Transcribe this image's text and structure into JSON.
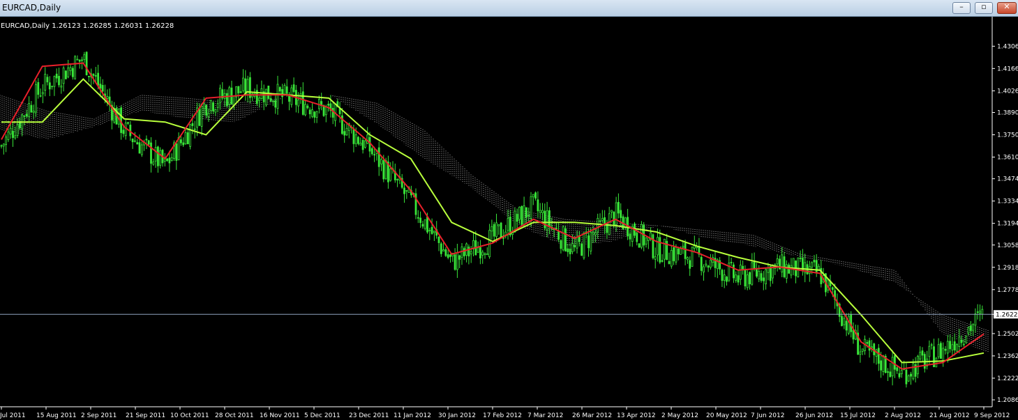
{
  "window": {
    "title": "EURCAD,Daily",
    "minimize_glyph": "–",
    "restore_glyph": "▫",
    "close_glyph": "✕"
  },
  "chart_info": {
    "text": "EURCAD,Daily  1.26123 1.26285 1.26031 1.26228"
  },
  "colors": {
    "background": "#000000",
    "candles": "#39e639",
    "tenkan": "#e8202a",
    "kijun": "#b8ff3c",
    "cloud": "#ffffff",
    "axis": "#ffffff",
    "current_price_line": "#8fa3c0"
  },
  "price_axis": [
    "1.43060",
    "1.41660",
    "1.40260",
    "1.38900",
    "1.37500",
    "1.36100",
    "1.34740",
    "1.33340",
    "1.31940",
    "1.30580",
    "1.29180",
    "1.27780",
    "1.26228",
    "1.25020",
    "1.23620",
    "1.22220",
    "1.20860"
  ],
  "current_price": "1.26228",
  "time_axis": [
    "Jul 2011",
    "15 Aug 2011",
    "2 Sep 2011",
    "21 Sep 2011",
    "10 Oct 2011",
    "28 Oct 2011",
    "16 Nov 2011",
    "5 Dec 2011",
    "23 Dec 2011",
    "11 Jan 2012",
    "30 Jan 2012",
    "17 Feb 2012",
    "7 Mar 2012",
    "26 Mar 2012",
    "13 Apr 2012",
    "2 May 2012",
    "20 May 2012",
    "7 Jun 2012",
    "26 Jun 2012",
    "15 Jul 2012",
    "2 Aug 2012",
    "21 Aug 2012",
    "9 Sep 2012"
  ],
  "chart_data": {
    "type": "candlestick",
    "symbol": "EURCAD",
    "timeframe": "Daily",
    "last_bar": {
      "open": 1.26123,
      "high": 1.26285,
      "low": 1.26031,
      "close": 1.26228
    },
    "ylim": [
      1.206,
      1.436
    ],
    "close_path": [
      {
        "date": "Jul 2011",
        "close": 1.368
      },
      {
        "date": "28 Jul 2011",
        "close": 1.405
      },
      {
        "date": "15 Aug 2011",
        "close": 1.423
      },
      {
        "date": "2 Sep 2011",
        "close": 1.378
      },
      {
        "date": "10 Sep 2011",
        "close": 1.355
      },
      {
        "date": "21 Sep 2011",
        "close": 1.395
      },
      {
        "date": "10 Oct 2011",
        "close": 1.404
      },
      {
        "date": "28 Oct 2011",
        "close": 1.398
      },
      {
        "date": "16 Nov 2011",
        "close": 1.39
      },
      {
        "date": "5 Dec 2011",
        "close": 1.366
      },
      {
        "date": "23 Dec 2011",
        "close": 1.333
      },
      {
        "date": "11 Jan 2012",
        "close": 1.295
      },
      {
        "date": "30 Jan 2012",
        "close": 1.31
      },
      {
        "date": "17 Feb 2012",
        "close": 1.33
      },
      {
        "date": "7 Mar 2012",
        "close": 1.302
      },
      {
        "date": "26 Mar 2012",
        "close": 1.325
      },
      {
        "date": "13 Apr 2012",
        "close": 1.303
      },
      {
        "date": "2 May 2012",
        "close": 1.298
      },
      {
        "date": "20 May 2012",
        "close": 1.285
      },
      {
        "date": "7 Jun 2012",
        "close": 1.292
      },
      {
        "date": "26 Jun 2012",
        "close": 1.288
      },
      {
        "date": "15 Jul 2012",
        "close": 1.24
      },
      {
        "date": "2 Aug 2012",
        "close": 1.225
      },
      {
        "date": "21 Aug 2012",
        "close": 1.24
      },
      {
        "date": "9 Sep 2012",
        "close": 1.262
      }
    ],
    "tenkan_sen": [
      1.372,
      1.418,
      1.42,
      1.38,
      1.36,
      1.398,
      1.4,
      1.4,
      1.392,
      1.37,
      1.34,
      1.3,
      1.307,
      1.322,
      1.31,
      1.322,
      1.308,
      1.301,
      1.29,
      1.292,
      1.288,
      1.245,
      1.228,
      1.232,
      1.25
    ],
    "kijun_sen": [
      1.383,
      1.383,
      1.41,
      1.385,
      1.383,
      1.375,
      1.402,
      1.4,
      1.398,
      1.375,
      1.36,
      1.32,
      1.308,
      1.32,
      1.32,
      1.318,
      1.314,
      1.305,
      1.298,
      1.292,
      1.29,
      1.262,
      1.232,
      1.233,
      1.238
    ],
    "senkou_a": [
      1.4,
      1.39,
      1.385,
      1.4,
      1.398,
      1.395,
      1.398,
      1.4,
      1.395,
      1.378,
      1.35,
      1.328,
      1.322,
      1.32,
      1.318,
      1.31,
      1.305,
      1.298,
      1.292,
      1.282,
      1.262,
      1.252
    ],
    "senkou_b": [
      1.378,
      1.372,
      1.38,
      1.39,
      1.385,
      1.383,
      1.398,
      1.4,
      1.382,
      1.36,
      1.342,
      1.318,
      1.305,
      1.308,
      1.318,
      1.315,
      1.312,
      1.3,
      1.295,
      1.29,
      1.25,
      1.238
    ]
  }
}
